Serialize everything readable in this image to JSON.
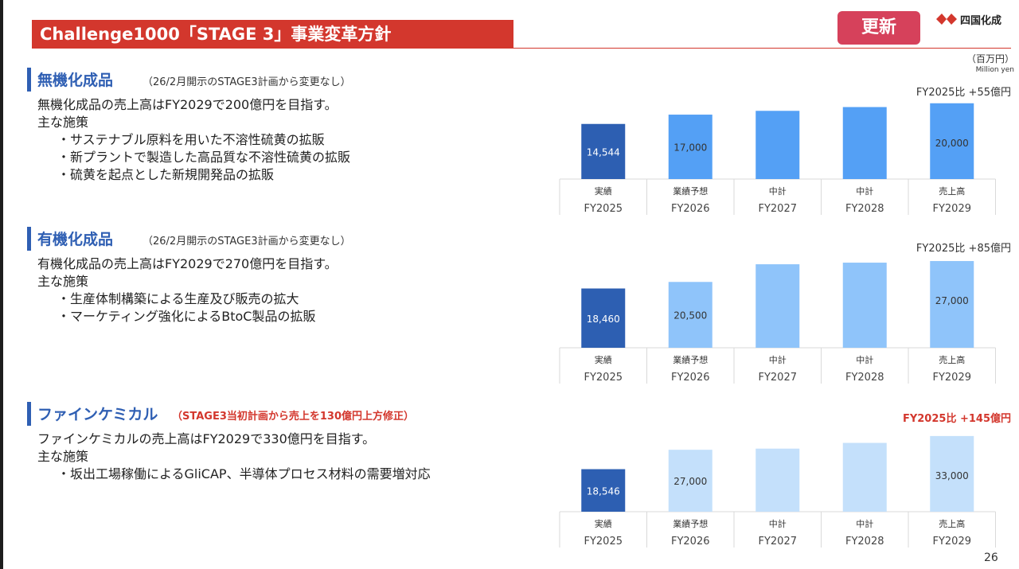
{
  "header": {
    "title": "Challenge1000「STAGE 3」事業変革方針",
    "update_badge": "更新",
    "logo_text": "四国化成",
    "unit_ja": "（百万円）",
    "unit_en": "Million yen",
    "page_number": "26"
  },
  "colors": {
    "title_bar": "#d3372d",
    "badge": "#d6415b",
    "heading_blue": "#2f5fb3",
    "actual_bar": "#2d5fb2"
  },
  "sections": [
    {
      "title": "無機化成品",
      "note": "（26/2月開示のSTAGE3計画から変更なし）",
      "note_emphasis": false,
      "lines": [
        "無機化成品の売上高はFY2029で200億円を目指す。",
        "主な施策"
      ],
      "items": [
        "・サステナブル原料を用いた不溶性硫黄の拡販",
        "・新プラントで製造した高品質な不溶性硫黄の拡販",
        "・硫黄を起点とした新規開発品の拡販"
      ]
    },
    {
      "title": "有機化成品",
      "note": "（26/2月開示のSTAGE3計画から変更なし）",
      "note_emphasis": false,
      "lines": [
        "有機化成品の売上高はFY2029で270億円を目指す。",
        "主な施策"
      ],
      "items": [
        "・生産体制構築による生産及び販売の拡大",
        "・マーケティング強化によるBtoC製品の拡販"
      ]
    },
    {
      "title": "ファインケミカル",
      "note": "（STAGE3当初計画から売上を130億円上方修正）",
      "note_emphasis": true,
      "lines": [
        "ファインケミカルの売上高はFY2029で330億円を目指す。",
        "主な施策"
      ],
      "items": [
        "・坂出工場稼働によるGliCAP、半導体プロセス材料の需要増対応"
      ]
    }
  ],
  "chart_data": [
    {
      "type": "bar",
      "categories": [
        "FY2025",
        "FY2026",
        "FY2027",
        "FY2028",
        "FY2029"
      ],
      "category_labels": [
        "実績",
        "業績予想",
        "中計",
        "中計",
        "売上高"
      ],
      "values": [
        14544,
        17000,
        18000,
        19000,
        20000
      ],
      "value_labels": [
        "14,544",
        "17,000",
        "",
        "",
        "20,000"
      ],
      "bar_colors": [
        "#2d5fb2",
        "#54a0f5",
        "#54a0f5",
        "#54a0f5",
        "#54a0f5"
      ],
      "annotation": "FY2025比 +55億円",
      "annotation_emphasis": false,
      "ylim": [
        0,
        21000
      ]
    },
    {
      "type": "bar",
      "categories": [
        "FY2025",
        "FY2026",
        "FY2027",
        "FY2028",
        "FY2029"
      ],
      "category_labels": [
        "実績",
        "業績予想",
        "中計",
        "中計",
        "売上高"
      ],
      "values": [
        18460,
        20500,
        26000,
        26500,
        27000
      ],
      "value_labels": [
        "18,460",
        "20,500",
        "",
        "",
        "27,000"
      ],
      "bar_colors": [
        "#2d5fb2",
        "#8fc4fa",
        "#8fc4fa",
        "#8fc4fa",
        "#8fc4fa"
      ],
      "annotation": "FY2025比 +85億円",
      "annotation_emphasis": false,
      "ylim": [
        0,
        28000
      ]
    },
    {
      "type": "bar",
      "categories": [
        "FY2025",
        "FY2026",
        "FY2027",
        "FY2028",
        "FY2029"
      ],
      "category_labels": [
        "実績",
        "業績予想",
        "中計",
        "中計",
        "売上高"
      ],
      "values": [
        18546,
        27000,
        27500,
        30000,
        33000
      ],
      "value_labels": [
        "18,546",
        "27,000",
        "",
        "",
        "33,000"
      ],
      "bar_colors": [
        "#2d5fb2",
        "#c4e0fb",
        "#c4e0fb",
        "#c4e0fb",
        "#c4e0fb"
      ],
      "annotation": "FY2025比 +145億円",
      "annotation_emphasis": true,
      "ylim": [
        0,
        34000
      ]
    }
  ]
}
